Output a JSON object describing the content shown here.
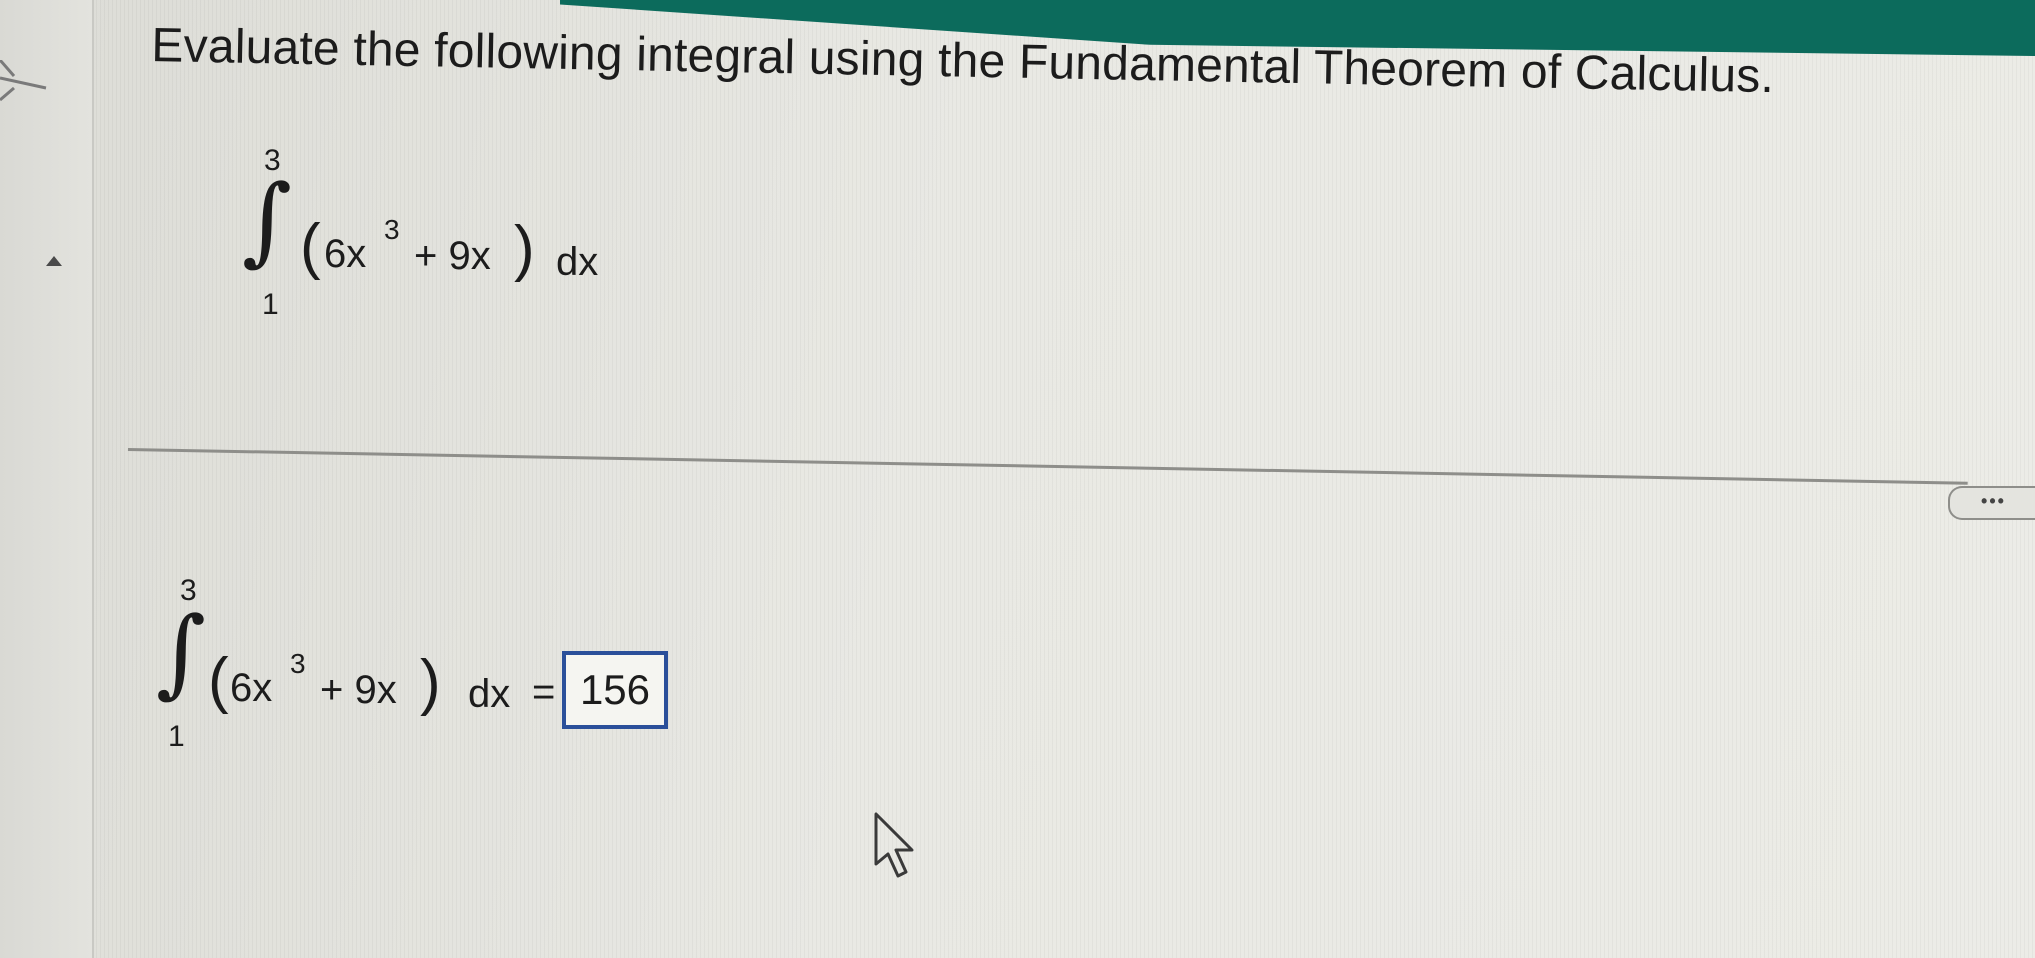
{
  "question": {
    "title": "Evaluate the following integral using the Fundamental Theorem of Calculus."
  },
  "integral": {
    "upper_limit": "3",
    "lower_limit": "1",
    "coef1": "6x",
    "exponent": "3",
    "plus_term": "+ 9x",
    "differential": "dx"
  },
  "answer": {
    "equals": "=",
    "value": "156"
  },
  "controls": {
    "more_label": "•••"
  },
  "icons": {
    "back": "back-arrow-icon",
    "scroll_up": "triangle-up-icon",
    "cursor": "mouse-pointer-icon"
  },
  "colors": {
    "banner": "#0c6b5c",
    "answer_border": "#2a4f9a"
  }
}
